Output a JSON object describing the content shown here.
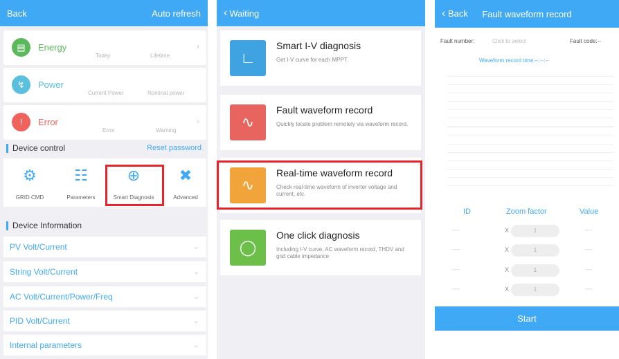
{
  "screen1": {
    "back": "Back",
    "auto_refresh": "Auto refresh",
    "cards": [
      {
        "label": "Energy",
        "sub1": "Today",
        "sub2": "Lifetime",
        "color": "#5cb85c",
        "icon": "leaf-chart-icon"
      },
      {
        "label": "Power",
        "sub1": "Current Power",
        "sub2": "Nominal power",
        "color": "#5bc0de",
        "icon": "lightning-icon"
      },
      {
        "label": "Error",
        "sub1": "Error",
        "sub2": "Warning",
        "color": "#f0635c",
        "icon": "alert-icon"
      }
    ],
    "device_control": "Device control",
    "reset_password": "Reset password",
    "controls": [
      "GRID CMD",
      "Parameters",
      "Smart Diagnosis",
      "Advanced"
    ],
    "device_information": "Device Information",
    "info_rows": [
      "PV Volt/Current",
      "String Volt/Current",
      "AC Volt/Current/Power/Freq",
      "PID Volt/Current",
      "Internal parameters"
    ]
  },
  "screen2": {
    "back": "Waiting",
    "items": [
      {
        "title": "Smart I-V diagnosis",
        "desc": "Get I-V curve for each MPPT.",
        "color": "#3ea3e0"
      },
      {
        "title": "Fault waveform record",
        "desc": "Quickly locate problem remotely via waveform record.",
        "color": "#e8645f"
      },
      {
        "title": "Real-time waveform record",
        "desc": "Check real-time waveform of inverter voltage and current, etc.",
        "color": "#f0a43a"
      },
      {
        "title": "One click diagnosis",
        "desc": "Including I-V curve, AC waveform record, THDV and grid cable impedance",
        "color": "#6cc04a"
      }
    ]
  },
  "screen3": {
    "back": "Back",
    "title": "Fault waveform record",
    "fault_number_label": "Fault number:",
    "fault_number_placeholder": "Click to select",
    "fault_code_label": "Fault code:--",
    "record_time": "Waveform record time:--:--:--",
    "col_id": "ID",
    "col_zoom": "Zoom factor",
    "col_value": "Value",
    "rows": [
      {
        "id": "----",
        "x": "X",
        "zoom": "1",
        "value": "----"
      },
      {
        "id": "----",
        "x": "X",
        "zoom": "1",
        "value": "----"
      },
      {
        "id": "----",
        "x": "X",
        "zoom": "1",
        "value": "----"
      },
      {
        "id": "----",
        "x": "X",
        "zoom": "1",
        "value": "----"
      }
    ],
    "start": "Start"
  }
}
